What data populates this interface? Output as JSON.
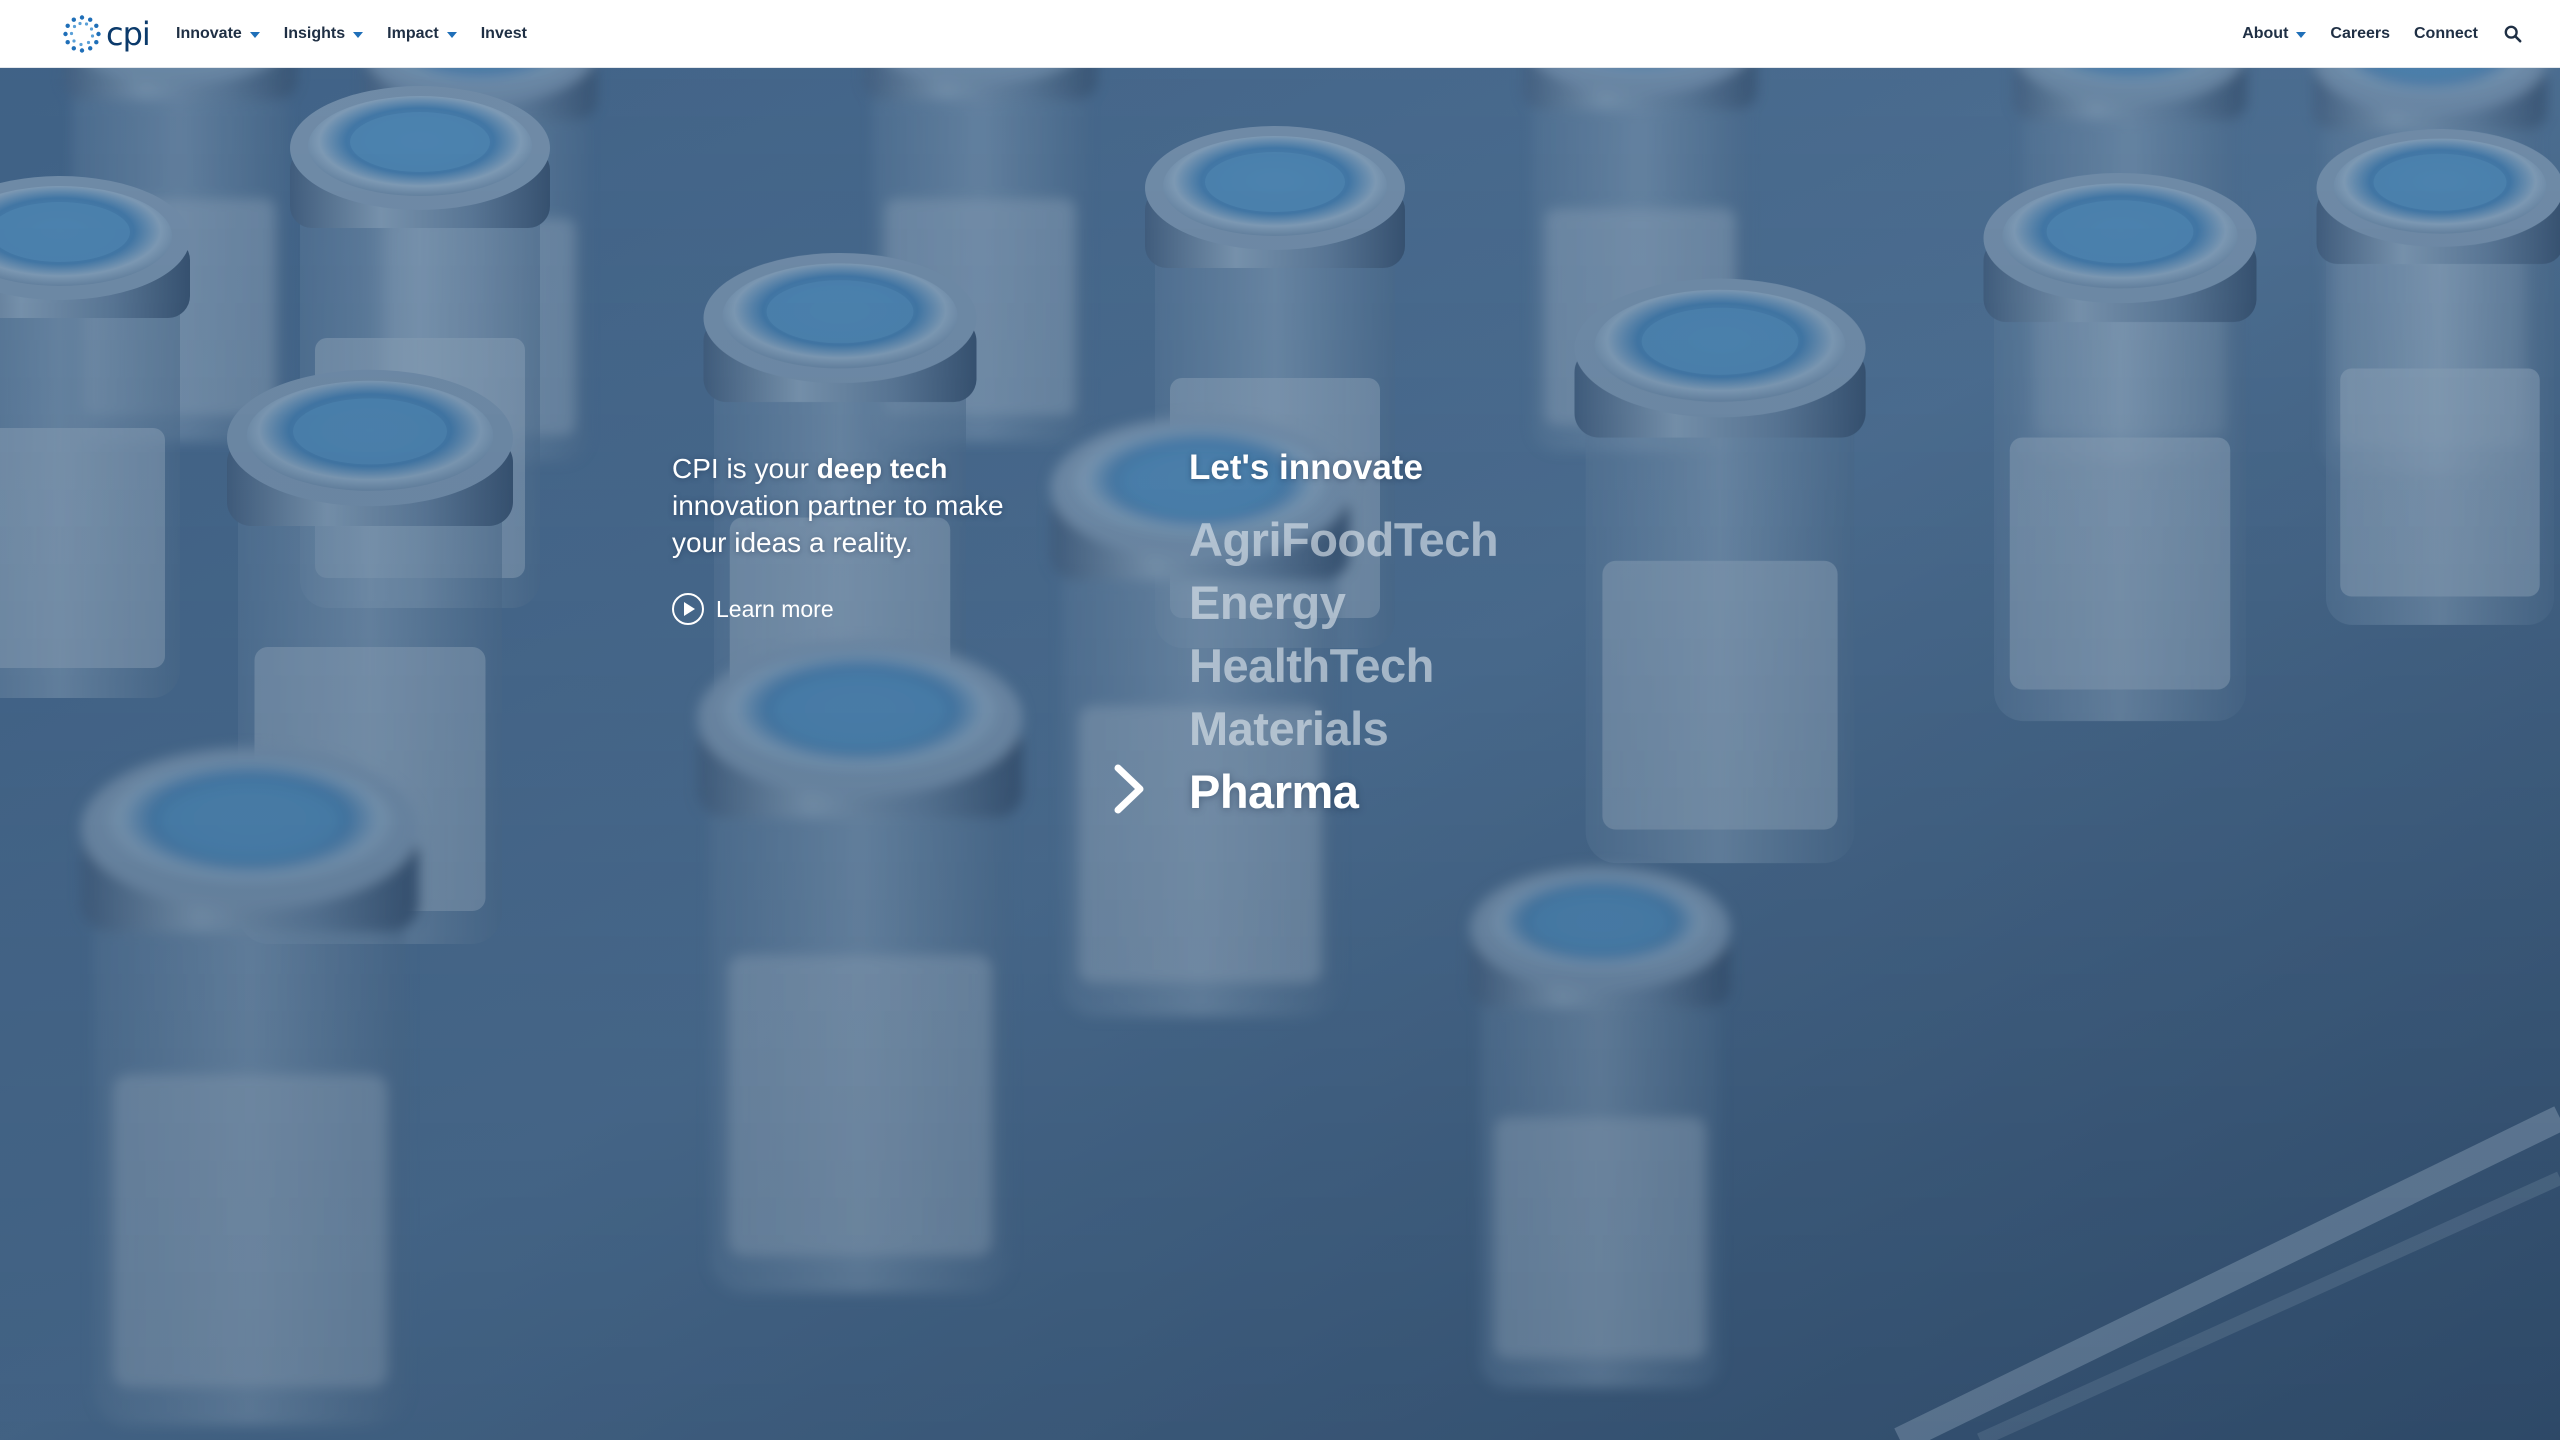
{
  "brand": {
    "logo_text": "cpi",
    "accent": "#1f6fb8"
  },
  "nav": {
    "left": [
      {
        "label": "Innovate",
        "has_dropdown": true
      },
      {
        "label": "Insights",
        "has_dropdown": true
      },
      {
        "label": "Impact",
        "has_dropdown": true
      },
      {
        "label": "Invest",
        "has_dropdown": false
      }
    ],
    "right": [
      {
        "label": "About",
        "has_dropdown": true
      },
      {
        "label": "Careers",
        "has_dropdown": false
      },
      {
        "label": "Connect",
        "has_dropdown": false
      }
    ],
    "search_icon": "search-icon"
  },
  "hero": {
    "intro_pre": "CPI is your ",
    "intro_bold": "deep tech",
    "intro_post": " innovation partner to make your ideas a reality.",
    "learn_more": "Learn more",
    "innovate_title": "Let's innovate",
    "sectors": [
      "AgriFoodTech",
      "Energy",
      "HealthTech",
      "Materials",
      "Pharma"
    ],
    "active_sector": "Pharma",
    "background_subject": "pharmaceutical vials",
    "tint_color": "#3b5f84"
  }
}
